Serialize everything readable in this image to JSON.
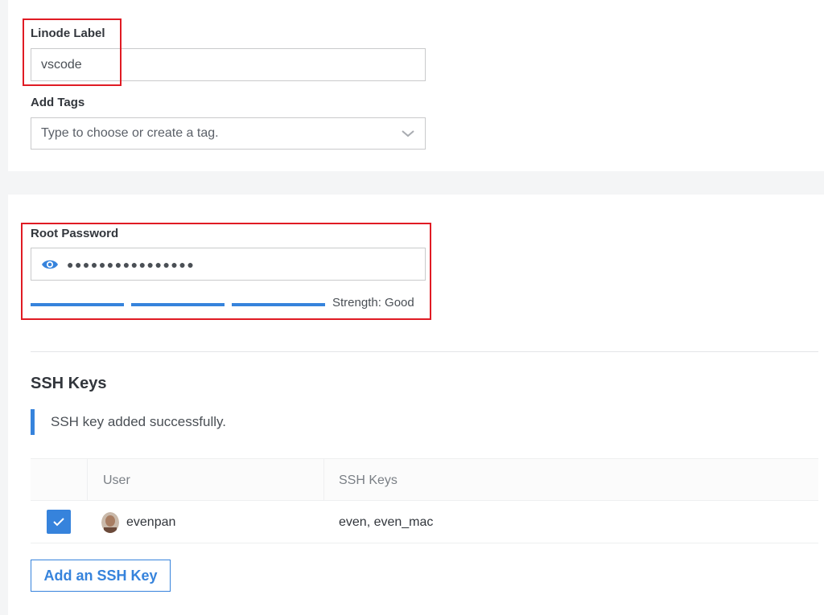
{
  "linode_label": {
    "label": "Linode Label",
    "value": "vscode"
  },
  "tags": {
    "label": "Add Tags",
    "placeholder": "Type to choose or create a tag."
  },
  "root_password": {
    "label": "Root Password",
    "masked_value": "●●●●●●●●●●●●●●●●",
    "strength_text": "Strength: Good",
    "strength_segments_filled": 3,
    "strength_segments_total": 3
  },
  "ssh_keys": {
    "title": "SSH Keys",
    "notice": "SSH key added successfully.",
    "columns": {
      "user": "User",
      "keys": "SSH Keys"
    },
    "rows": [
      {
        "checked": true,
        "user": "evenpan",
        "keys": "even, even_mac"
      }
    ],
    "add_button": "Add an SSH Key"
  },
  "colors": {
    "accent": "#3683dc",
    "highlight": "#e01b24",
    "text": "#32363c"
  },
  "icons": {
    "select": "chevron-down-icon",
    "password_toggle": "eye-icon",
    "checkbox": "checkmark-icon"
  }
}
